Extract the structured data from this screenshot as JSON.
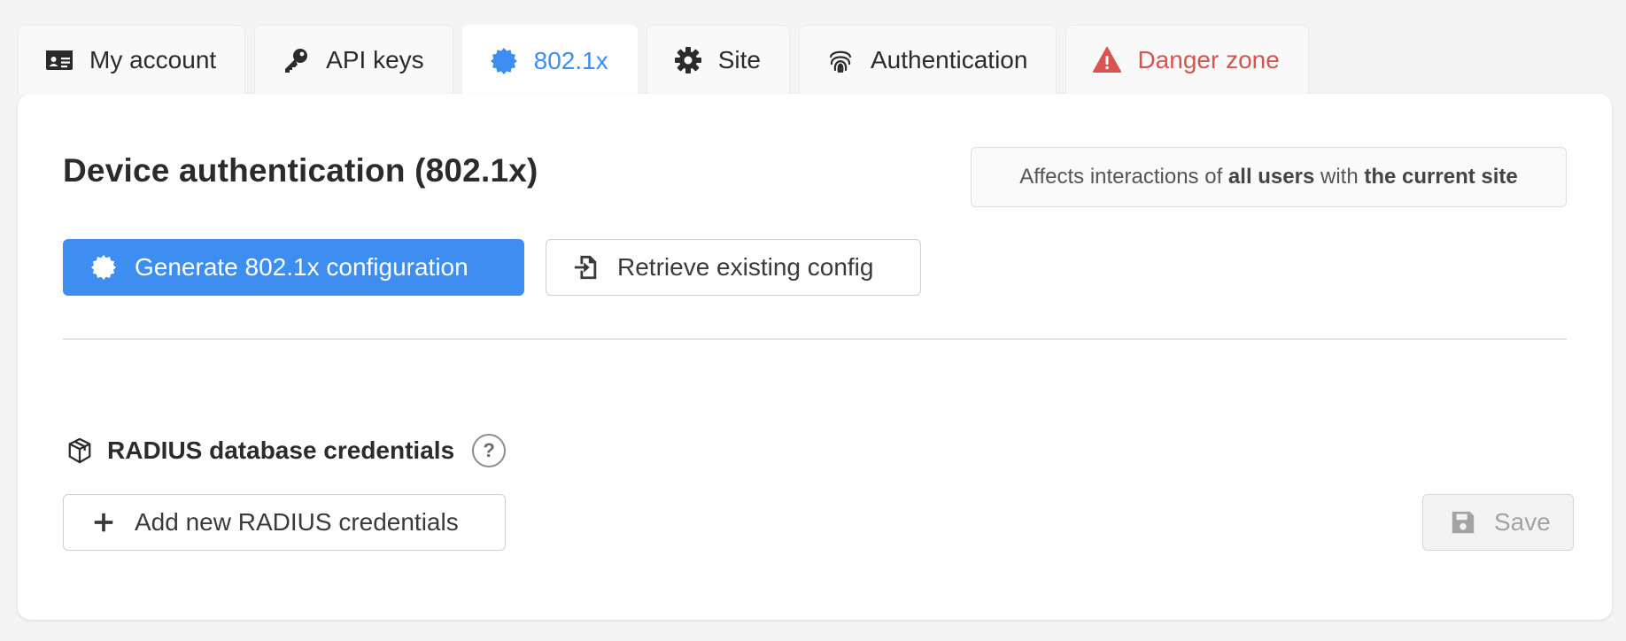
{
  "tabs": [
    {
      "label": "My account",
      "icon": "id-card-icon"
    },
    {
      "label": "API keys",
      "icon": "key-icon"
    },
    {
      "label": "802.1x",
      "icon": "certificate-icon",
      "active": true
    },
    {
      "label": "Site",
      "icon": "gear-icon"
    },
    {
      "label": "Authentication",
      "icon": "fingerprint-icon"
    },
    {
      "label": "Danger zone",
      "icon": "warning-icon"
    }
  ],
  "colors": {
    "accent": "#3d8ef0",
    "danger": "#d9534f"
  },
  "page": {
    "title": "Device authentication (802.1x)"
  },
  "scope_note": {
    "prefix": "Affects interactions of",
    "bold1": "all users",
    "middle": "with",
    "bold2": "the current site"
  },
  "actions": {
    "generate_label": "Generate 802.1x configuration",
    "retrieve_label": "Retrieve existing config"
  },
  "radius": {
    "title": "RADIUS database credentials",
    "help_glyph": "?",
    "add_label": "Add new RADIUS credentials",
    "save_label": "Save"
  }
}
